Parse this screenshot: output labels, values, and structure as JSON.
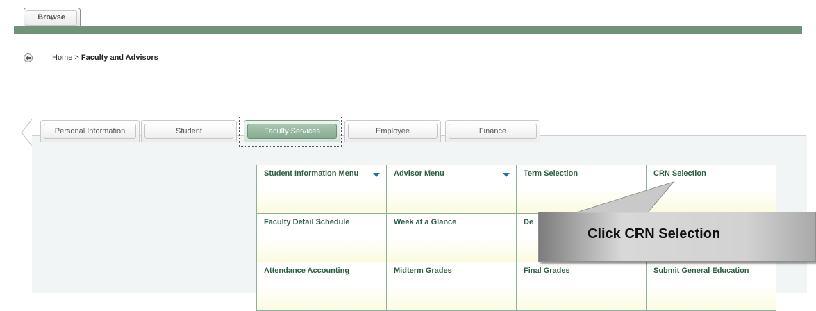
{
  "toolbar": {
    "browse_label": "Browse"
  },
  "breadcrumb": {
    "home": "Home",
    "separator": ">",
    "current": "Faculty and Advisors"
  },
  "tabs": [
    {
      "label": "Personal Information",
      "active": false
    },
    {
      "label": "Student",
      "active": false
    },
    {
      "label": "Faculty Services",
      "active": true
    },
    {
      "label": "Employee",
      "active": false
    },
    {
      "label": "Finance",
      "active": false
    }
  ],
  "menu_grid": {
    "rows": [
      [
        {
          "label": "Student Information Menu",
          "dropdown": true
        },
        {
          "label": "Advisor Menu",
          "dropdown": true
        },
        {
          "label": "Term Selection"
        },
        {
          "label": "CRN Selection"
        }
      ],
      [
        {
          "label": "Faculty Detail Schedule"
        },
        {
          "label": "Week at a Glance"
        },
        {
          "label": "De"
        },
        {
          "label": ""
        }
      ],
      [
        {
          "label": "Attendance Accounting"
        },
        {
          "label": "Midterm Grades"
        },
        {
          "label": "Final Grades"
        },
        {
          "label": "Submit General Education"
        }
      ]
    ]
  },
  "callout": {
    "text": "Click CRN Selection"
  },
  "colors": {
    "green_bar": "#6f9478",
    "cell_text": "#2e5e41",
    "dropdown_arrow": "#2a6f9f"
  }
}
